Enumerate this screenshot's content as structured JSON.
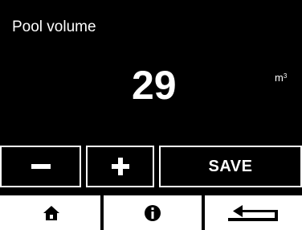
{
  "screen": {
    "title": "Pool volume",
    "value": "29",
    "unit": "m",
    "unit_exponent": "3"
  },
  "buttons": {
    "decrease": {
      "icon": "minus-icon"
    },
    "increase": {
      "icon": "plus-icon"
    },
    "save_label": "SAVE"
  },
  "navbar": {
    "home": {
      "icon": "home-icon"
    },
    "info": {
      "icon": "info-icon"
    },
    "back": {
      "icon": "back-arrow-icon"
    }
  },
  "colors": {
    "background": "#000000",
    "foreground": "#ffffff"
  }
}
